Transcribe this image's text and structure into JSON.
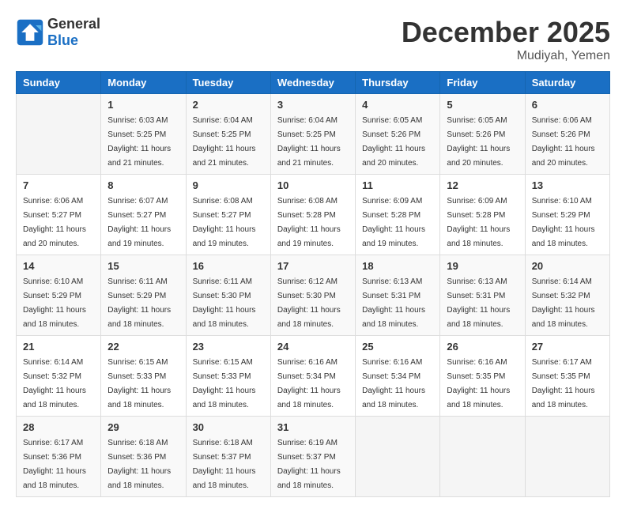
{
  "header": {
    "logo_general": "General",
    "logo_blue": "Blue",
    "month_title": "December 2025",
    "location": "Mudiyah, Yemen"
  },
  "weekdays": [
    "Sunday",
    "Monday",
    "Tuesday",
    "Wednesday",
    "Thursday",
    "Friday",
    "Saturday"
  ],
  "weeks": [
    [
      {
        "day": "",
        "sunrise": "",
        "sunset": "",
        "daylight": ""
      },
      {
        "day": "1",
        "sunrise": "Sunrise: 6:03 AM",
        "sunset": "Sunset: 5:25 PM",
        "daylight": "Daylight: 11 hours and 21 minutes."
      },
      {
        "day": "2",
        "sunrise": "Sunrise: 6:04 AM",
        "sunset": "Sunset: 5:25 PM",
        "daylight": "Daylight: 11 hours and 21 minutes."
      },
      {
        "day": "3",
        "sunrise": "Sunrise: 6:04 AM",
        "sunset": "Sunset: 5:25 PM",
        "daylight": "Daylight: 11 hours and 21 minutes."
      },
      {
        "day": "4",
        "sunrise": "Sunrise: 6:05 AM",
        "sunset": "Sunset: 5:26 PM",
        "daylight": "Daylight: 11 hours and 20 minutes."
      },
      {
        "day": "5",
        "sunrise": "Sunrise: 6:05 AM",
        "sunset": "Sunset: 5:26 PM",
        "daylight": "Daylight: 11 hours and 20 minutes."
      },
      {
        "day": "6",
        "sunrise": "Sunrise: 6:06 AM",
        "sunset": "Sunset: 5:26 PM",
        "daylight": "Daylight: 11 hours and 20 minutes."
      }
    ],
    [
      {
        "day": "7",
        "sunrise": "Sunrise: 6:06 AM",
        "sunset": "Sunset: 5:27 PM",
        "daylight": "Daylight: 11 hours and 20 minutes."
      },
      {
        "day": "8",
        "sunrise": "Sunrise: 6:07 AM",
        "sunset": "Sunset: 5:27 PM",
        "daylight": "Daylight: 11 hours and 19 minutes."
      },
      {
        "day": "9",
        "sunrise": "Sunrise: 6:08 AM",
        "sunset": "Sunset: 5:27 PM",
        "daylight": "Daylight: 11 hours and 19 minutes."
      },
      {
        "day": "10",
        "sunrise": "Sunrise: 6:08 AM",
        "sunset": "Sunset: 5:28 PM",
        "daylight": "Daylight: 11 hours and 19 minutes."
      },
      {
        "day": "11",
        "sunrise": "Sunrise: 6:09 AM",
        "sunset": "Sunset: 5:28 PM",
        "daylight": "Daylight: 11 hours and 19 minutes."
      },
      {
        "day": "12",
        "sunrise": "Sunrise: 6:09 AM",
        "sunset": "Sunset: 5:28 PM",
        "daylight": "Daylight: 11 hours and 18 minutes."
      },
      {
        "day": "13",
        "sunrise": "Sunrise: 6:10 AM",
        "sunset": "Sunset: 5:29 PM",
        "daylight": "Daylight: 11 hours and 18 minutes."
      }
    ],
    [
      {
        "day": "14",
        "sunrise": "Sunrise: 6:10 AM",
        "sunset": "Sunset: 5:29 PM",
        "daylight": "Daylight: 11 hours and 18 minutes."
      },
      {
        "day": "15",
        "sunrise": "Sunrise: 6:11 AM",
        "sunset": "Sunset: 5:29 PM",
        "daylight": "Daylight: 11 hours and 18 minutes."
      },
      {
        "day": "16",
        "sunrise": "Sunrise: 6:11 AM",
        "sunset": "Sunset: 5:30 PM",
        "daylight": "Daylight: 11 hours and 18 minutes."
      },
      {
        "day": "17",
        "sunrise": "Sunrise: 6:12 AM",
        "sunset": "Sunset: 5:30 PM",
        "daylight": "Daylight: 11 hours and 18 minutes."
      },
      {
        "day": "18",
        "sunrise": "Sunrise: 6:13 AM",
        "sunset": "Sunset: 5:31 PM",
        "daylight": "Daylight: 11 hours and 18 minutes."
      },
      {
        "day": "19",
        "sunrise": "Sunrise: 6:13 AM",
        "sunset": "Sunset: 5:31 PM",
        "daylight": "Daylight: 11 hours and 18 minutes."
      },
      {
        "day": "20",
        "sunrise": "Sunrise: 6:14 AM",
        "sunset": "Sunset: 5:32 PM",
        "daylight": "Daylight: 11 hours and 18 minutes."
      }
    ],
    [
      {
        "day": "21",
        "sunrise": "Sunrise: 6:14 AM",
        "sunset": "Sunset: 5:32 PM",
        "daylight": "Daylight: 11 hours and 18 minutes."
      },
      {
        "day": "22",
        "sunrise": "Sunrise: 6:15 AM",
        "sunset": "Sunset: 5:33 PM",
        "daylight": "Daylight: 11 hours and 18 minutes."
      },
      {
        "day": "23",
        "sunrise": "Sunrise: 6:15 AM",
        "sunset": "Sunset: 5:33 PM",
        "daylight": "Daylight: 11 hours and 18 minutes."
      },
      {
        "day": "24",
        "sunrise": "Sunrise: 6:16 AM",
        "sunset": "Sunset: 5:34 PM",
        "daylight": "Daylight: 11 hours and 18 minutes."
      },
      {
        "day": "25",
        "sunrise": "Sunrise: 6:16 AM",
        "sunset": "Sunset: 5:34 PM",
        "daylight": "Daylight: 11 hours and 18 minutes."
      },
      {
        "day": "26",
        "sunrise": "Sunrise: 6:16 AM",
        "sunset": "Sunset: 5:35 PM",
        "daylight": "Daylight: 11 hours and 18 minutes."
      },
      {
        "day": "27",
        "sunrise": "Sunrise: 6:17 AM",
        "sunset": "Sunset: 5:35 PM",
        "daylight": "Daylight: 11 hours and 18 minutes."
      }
    ],
    [
      {
        "day": "28",
        "sunrise": "Sunrise: 6:17 AM",
        "sunset": "Sunset: 5:36 PM",
        "daylight": "Daylight: 11 hours and 18 minutes."
      },
      {
        "day": "29",
        "sunrise": "Sunrise: 6:18 AM",
        "sunset": "Sunset: 5:36 PM",
        "daylight": "Daylight: 11 hours and 18 minutes."
      },
      {
        "day": "30",
        "sunrise": "Sunrise: 6:18 AM",
        "sunset": "Sunset: 5:37 PM",
        "daylight": "Daylight: 11 hours and 18 minutes."
      },
      {
        "day": "31",
        "sunrise": "Sunrise: 6:19 AM",
        "sunset": "Sunset: 5:37 PM",
        "daylight": "Daylight: 11 hours and 18 minutes."
      },
      {
        "day": "",
        "sunrise": "",
        "sunset": "",
        "daylight": ""
      },
      {
        "day": "",
        "sunrise": "",
        "sunset": "",
        "daylight": ""
      },
      {
        "day": "",
        "sunrise": "",
        "sunset": "",
        "daylight": ""
      }
    ]
  ]
}
